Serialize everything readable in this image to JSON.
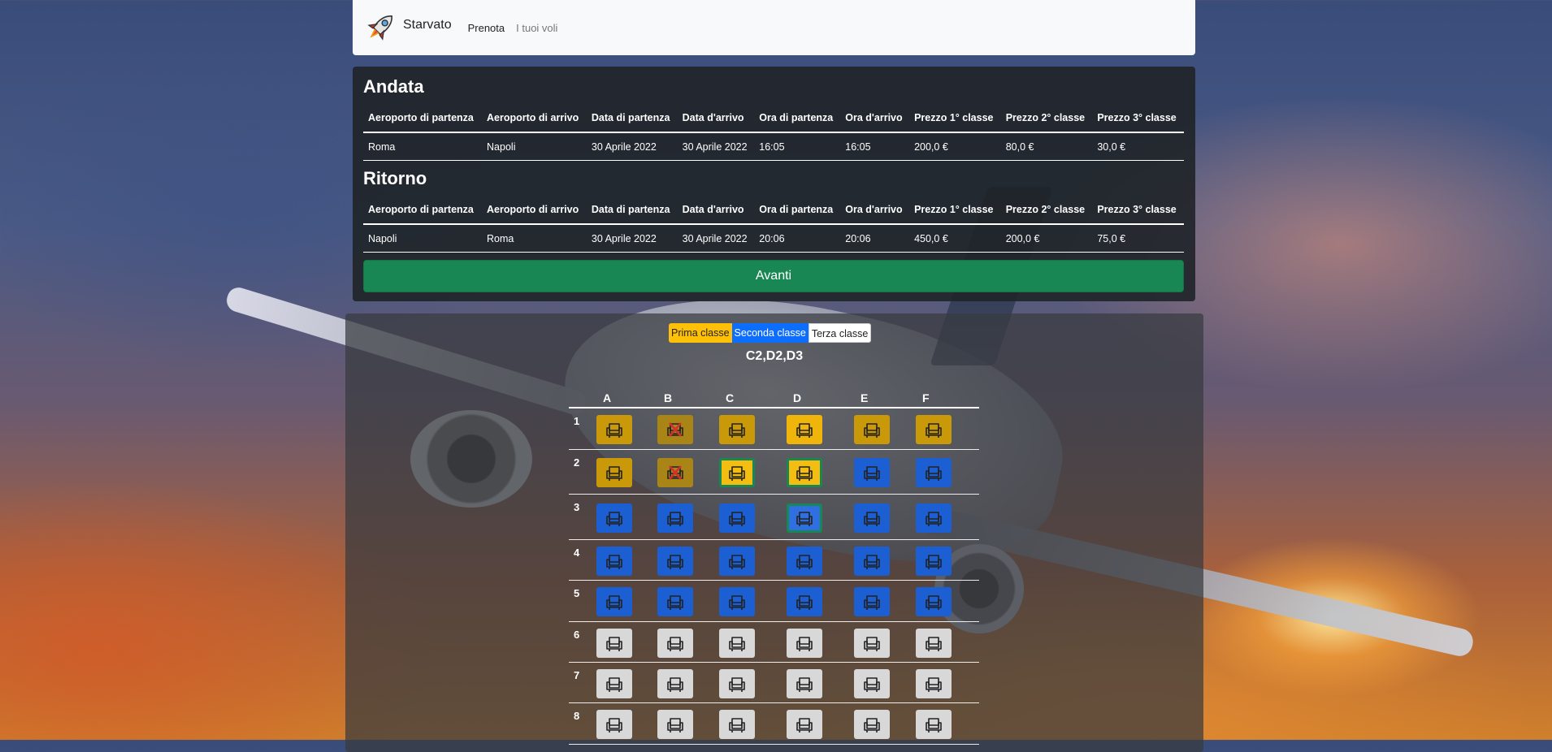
{
  "navbar": {
    "brand": "Starvato",
    "links": [
      {
        "label": "Prenota",
        "active": true
      },
      {
        "label": "I tuoi voli",
        "active": false
      }
    ]
  },
  "outbound": {
    "title": "Andata",
    "headers": [
      "Aeroporto di partenza",
      "Aeroporto di arrivo",
      "Data di partenza",
      "Data d'arrivo",
      "Ora di partenza",
      "Ora d'arrivo",
      "Prezzo 1° classe",
      "Prezzo 2° classe",
      "Prezzo 3° classe"
    ],
    "row": [
      "Roma",
      "Napoli",
      "30 Aprile 2022",
      "30 Aprile 2022",
      "16:05",
      "16:05",
      "200,0 €",
      "80,0 €",
      "30,0 €"
    ]
  },
  "return": {
    "title": "Ritorno",
    "headers": [
      "Aeroporto di partenza",
      "Aeroporto di arrivo",
      "Data di partenza",
      "Data d'arrivo",
      "Ora di partenza",
      "Ora d'arrivo",
      "Prezzo 1° classe",
      "Prezzo 2° classe",
      "Prezzo 3° classe"
    ],
    "row": [
      "Napoli",
      "Roma",
      "30 Aprile 2022",
      "30 Aprile 2022",
      "20:06",
      "20:06",
      "450,0 €",
      "200,0 €",
      "75,0 €"
    ]
  },
  "next_button": "Avanti",
  "legend": {
    "first": "Prima classe",
    "second": "Seconda classe",
    "third": "Terza classe"
  },
  "selected_seats": "C2,D2,D3",
  "seat_map": {
    "columns": [
      "A",
      "B",
      "C",
      "D",
      "E",
      "F"
    ],
    "rows": [
      {
        "label": "1",
        "seats": [
          {
            "class": "first",
            "state": "free"
          },
          {
            "class": "first",
            "state": "taken"
          },
          {
            "class": "first",
            "state": "free"
          },
          {
            "class": "first",
            "state": "free",
            "bright": true
          },
          {
            "class": "first",
            "state": "free"
          },
          {
            "class": "first",
            "state": "free"
          }
        ]
      },
      {
        "label": "2",
        "seats": [
          {
            "class": "first",
            "state": "free"
          },
          {
            "class": "first",
            "state": "taken"
          },
          {
            "class": "first",
            "state": "selected"
          },
          {
            "class": "first",
            "state": "selected"
          },
          {
            "class": "second",
            "state": "free"
          },
          {
            "class": "second",
            "state": "free"
          }
        ]
      },
      {
        "label": "3",
        "seats": [
          {
            "class": "second",
            "state": "free"
          },
          {
            "class": "second",
            "state": "free"
          },
          {
            "class": "second",
            "state": "free"
          },
          {
            "class": "second",
            "state": "selected"
          },
          {
            "class": "second",
            "state": "free"
          },
          {
            "class": "second",
            "state": "free"
          }
        ]
      },
      {
        "label": "4",
        "seats": [
          {
            "class": "second",
            "state": "free"
          },
          {
            "class": "second",
            "state": "free"
          },
          {
            "class": "second",
            "state": "free"
          },
          {
            "class": "second",
            "state": "free"
          },
          {
            "class": "second",
            "state": "free"
          },
          {
            "class": "second",
            "state": "free"
          }
        ]
      },
      {
        "label": "5",
        "seats": [
          {
            "class": "second",
            "state": "free"
          },
          {
            "class": "second",
            "state": "free"
          },
          {
            "class": "second",
            "state": "free"
          },
          {
            "class": "second",
            "state": "free"
          },
          {
            "class": "second",
            "state": "free"
          },
          {
            "class": "second",
            "state": "free"
          }
        ]
      },
      {
        "label": "6",
        "seats": [
          {
            "class": "third",
            "state": "free"
          },
          {
            "class": "third",
            "state": "free"
          },
          {
            "class": "third",
            "state": "free"
          },
          {
            "class": "third",
            "state": "free"
          },
          {
            "class": "third",
            "state": "free"
          },
          {
            "class": "third",
            "state": "free"
          }
        ]
      },
      {
        "label": "7",
        "seats": [
          {
            "class": "third",
            "state": "free"
          },
          {
            "class": "third",
            "state": "free"
          },
          {
            "class": "third",
            "state": "free"
          },
          {
            "class": "third",
            "state": "free"
          },
          {
            "class": "third",
            "state": "free"
          },
          {
            "class": "third",
            "state": "free"
          }
        ]
      },
      {
        "label": "8",
        "seats": [
          {
            "class": "third",
            "state": "free"
          },
          {
            "class": "third",
            "state": "free"
          },
          {
            "class": "third",
            "state": "free"
          },
          {
            "class": "third",
            "state": "free"
          },
          {
            "class": "third",
            "state": "free"
          },
          {
            "class": "third",
            "state": "free"
          }
        ]
      }
    ]
  },
  "icons": {
    "logo": "rocket-icon",
    "seat": "armchair-icon",
    "taken": "x-mark-icon"
  },
  "colors": {
    "first_class": "#ffc107",
    "second_class": "#0d6efd",
    "third_class": "#ffffff",
    "selected_border": "#198754",
    "button": "#198754"
  }
}
